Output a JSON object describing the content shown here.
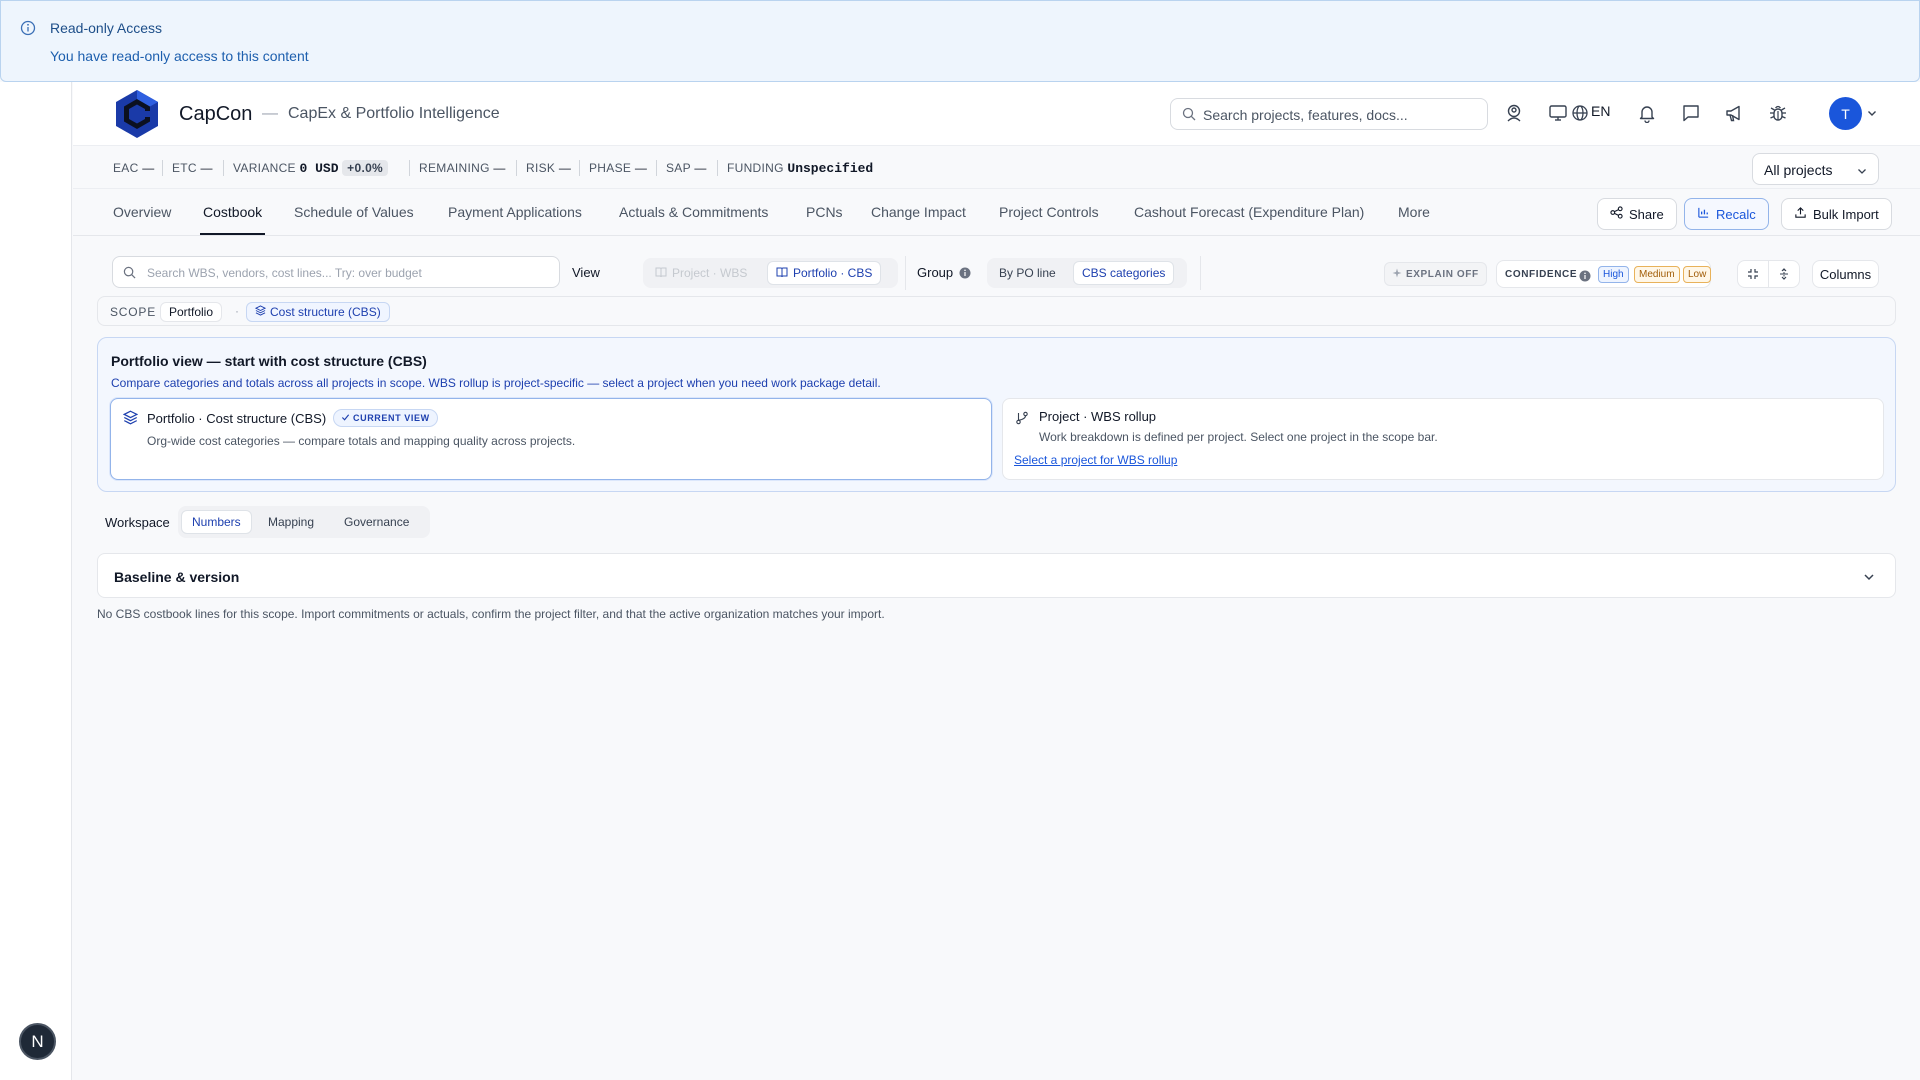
{
  "alert": {
    "title": "Read-only Access",
    "message": "You have read-only access to this content"
  },
  "header": {
    "brand": "CapCon",
    "separator": "—",
    "tagline": "CapEx & Portfolio Intelligence",
    "search_placeholder": "Search projects, features, docs...",
    "language": "EN",
    "avatar_initial": "T"
  },
  "metrics": {
    "eac_label": "EAC",
    "eac_value": "—",
    "etc_label": "ETC",
    "etc_value": "—",
    "variance_label": "VARIANCE",
    "variance_value": "0 USD",
    "variance_pct": "+0.0%",
    "remaining_label": "REMAINING",
    "remaining_value": "—",
    "risk_label": "RISK",
    "risk_value": "—",
    "phase_label": "PHASE",
    "phase_value": "—",
    "sap_label": "SAP",
    "sap_value": "—",
    "funding_label": "FUNDING",
    "funding_value": "Unspecified",
    "project_filter": "All projects"
  },
  "tabs": [
    {
      "label": "Overview"
    },
    {
      "label": "Costbook"
    },
    {
      "label": "Schedule of Values"
    },
    {
      "label": "Payment Applications"
    },
    {
      "label": "Actuals & Commitments"
    },
    {
      "label": "PCNs"
    },
    {
      "label": "Change Impact"
    },
    {
      "label": "Project Controls"
    },
    {
      "label": "Cashout Forecast (Expenditure Plan)"
    },
    {
      "label": "More"
    }
  ],
  "actions": {
    "share": "Share",
    "recalc": "Recalc",
    "bulk_import": "Bulk Import"
  },
  "toolbar": {
    "search_placeholder": "Search WBS, vendors, cost lines... Try: over budget",
    "view_label": "View",
    "view_project": "Project · WBS",
    "view_portfolio": "Portfolio · CBS",
    "group_label": "Group",
    "group_po": "By PO line",
    "group_cbs": "CBS categories",
    "explain": "EXPLAIN OFF",
    "confidence_label": "CONFIDENCE",
    "conf_high": "High",
    "conf_medium": "Medium",
    "conf_low": "Low",
    "columns": "Columns"
  },
  "scope": {
    "label": "SCOPE",
    "portfolio": "Portfolio",
    "separator": "·",
    "cbs": "Cost structure (CBS)"
  },
  "portfolio_view": {
    "title": "Portfolio view — start with cost structure (CBS)",
    "description": "Compare categories and totals across all projects in scope. WBS rollup is project-specific — select a project when you need work package detail.",
    "current": {
      "title": "Portfolio · Cost structure (CBS)",
      "badge": "CURRENT VIEW",
      "desc": "Org-wide cost categories — compare totals and mapping quality across projects."
    },
    "alt": {
      "title": "Project · WBS rollup",
      "desc": "Work breakdown is defined per project. Select one project in the scope bar.",
      "link": "Select a project for WBS rollup"
    }
  },
  "workspace": {
    "label": "Workspace",
    "numbers": "Numbers",
    "mapping": "Mapping",
    "governance": "Governance"
  },
  "baseline": {
    "title": "Baseline & version"
  },
  "empty_message": "No CBS costbook lines for this scope. Import commitments or actuals, confirm the project filter, and that the active organization matches your import.",
  "rail": {
    "badge": "N"
  }
}
